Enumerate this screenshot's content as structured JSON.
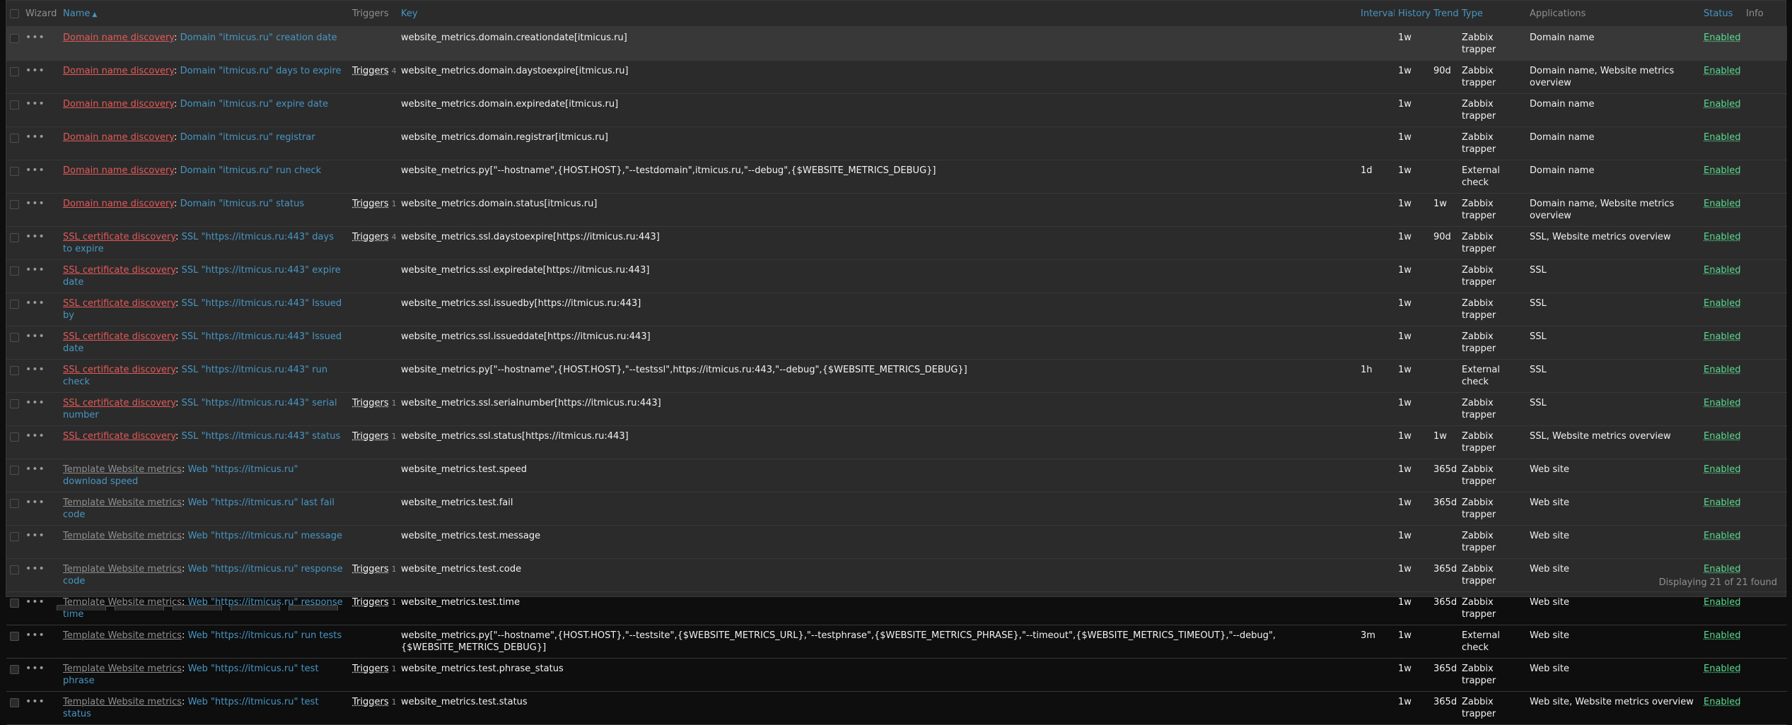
{
  "headers": {
    "wizard": "Wizard",
    "name": "Name",
    "name_sort": "▲",
    "triggers": "Triggers",
    "key": "Key",
    "interval": "Interval",
    "history": "History",
    "trends": "Trends",
    "type": "Type",
    "applications": "Applications",
    "status": "Status",
    "info": "Info"
  },
  "rows": [
    {
      "parent": "Domain name discovery",
      "parent_style": "red",
      "name": "Domain \"itmicus.ru\" creation date",
      "triggers": "",
      "trig_count": "",
      "key": "website_metrics.domain.creationdate[itmicus.ru]",
      "interval": "",
      "history": "1w",
      "trends": "",
      "type": "Zabbix trapper",
      "apps": "Domain name",
      "status": "Enabled"
    },
    {
      "parent": "Domain name discovery",
      "parent_style": "red",
      "name": "Domain \"itmicus.ru\" days to expire",
      "triggers": "Triggers",
      "trig_count": "4",
      "key": "website_metrics.domain.daystoexpire[itmicus.ru]",
      "interval": "",
      "history": "1w",
      "trends": "90d",
      "type": "Zabbix trapper",
      "apps": "Domain name, Website metrics overview",
      "status": "Enabled"
    },
    {
      "parent": "Domain name discovery",
      "parent_style": "red",
      "name": "Domain \"itmicus.ru\" expire date",
      "triggers": "",
      "trig_count": "",
      "key": "website_metrics.domain.expiredate[itmicus.ru]",
      "interval": "",
      "history": "1w",
      "trends": "",
      "type": "Zabbix trapper",
      "apps": "Domain name",
      "status": "Enabled"
    },
    {
      "parent": "Domain name discovery",
      "parent_style": "red",
      "name": "Domain \"itmicus.ru\" registrar",
      "triggers": "",
      "trig_count": "",
      "key": "website_metrics.domain.registrar[itmicus.ru]",
      "interval": "",
      "history": "1w",
      "trends": "",
      "type": "Zabbix trapper",
      "apps": "Domain name",
      "status": "Enabled"
    },
    {
      "parent": "Domain name discovery",
      "parent_style": "red",
      "name": "Domain \"itmicus.ru\" run check",
      "triggers": "",
      "trig_count": "",
      "key": "website_metrics.py[\"--hostname\",{HOST.HOST},\"--testdomain\",itmicus.ru,\"--debug\",{$WEBSITE_METRICS_DEBUG}]",
      "interval": "1d",
      "history": "1w",
      "trends": "",
      "type": "External check",
      "apps": "Domain name",
      "status": "Enabled"
    },
    {
      "parent": "Domain name discovery",
      "parent_style": "red",
      "name": "Domain \"itmicus.ru\" status",
      "triggers": "Triggers",
      "trig_count": "1",
      "key": "website_metrics.domain.status[itmicus.ru]",
      "interval": "",
      "history": "1w",
      "trends": "1w",
      "type": "Zabbix trapper",
      "apps": "Domain name, Website metrics overview",
      "status": "Enabled"
    },
    {
      "parent": "SSL certificate discovery",
      "parent_style": "red",
      "name": "SSL \"https://itmicus.ru:443\" days to expire",
      "triggers": "Triggers",
      "trig_count": "4",
      "key": "website_metrics.ssl.daystoexpire[https://itmicus.ru:443]",
      "interval": "",
      "history": "1w",
      "trends": "90d",
      "type": "Zabbix trapper",
      "apps": "SSL, Website metrics overview",
      "status": "Enabled"
    },
    {
      "parent": "SSL certificate discovery",
      "parent_style": "red",
      "name": "SSL \"https://itmicus.ru:443\" expire date",
      "triggers": "",
      "trig_count": "",
      "key": "website_metrics.ssl.expiredate[https://itmicus.ru:443]",
      "interval": "",
      "history": "1w",
      "trends": "",
      "type": "Zabbix trapper",
      "apps": "SSL",
      "status": "Enabled"
    },
    {
      "parent": "SSL certificate discovery",
      "parent_style": "red",
      "name": "SSL \"https://itmicus.ru:443\" Issued by",
      "triggers": "",
      "trig_count": "",
      "key": "website_metrics.ssl.issuedby[https://itmicus.ru:443]",
      "interval": "",
      "history": "1w",
      "trends": "",
      "type": "Zabbix trapper",
      "apps": "SSL",
      "status": "Enabled"
    },
    {
      "parent": "SSL certificate discovery",
      "parent_style": "red",
      "name": "SSL \"https://itmicus.ru:443\" Issued date",
      "triggers": "",
      "trig_count": "",
      "key": "website_metrics.ssl.issueddate[https://itmicus.ru:443]",
      "interval": "",
      "history": "1w",
      "trends": "",
      "type": "Zabbix trapper",
      "apps": "SSL",
      "status": "Enabled"
    },
    {
      "parent": "SSL certificate discovery",
      "parent_style": "red",
      "name": "SSL \"https://itmicus.ru:443\" run check",
      "triggers": "",
      "trig_count": "",
      "key": "website_metrics.py[\"--hostname\",{HOST.HOST},\"--testssl\",https://itmicus.ru:443,\"--debug\",{$WEBSITE_METRICS_DEBUG}]",
      "interval": "1h",
      "history": "1w",
      "trends": "",
      "type": "External check",
      "apps": "SSL",
      "status": "Enabled"
    },
    {
      "parent": "SSL certificate discovery",
      "parent_style": "red",
      "name": "SSL \"https://itmicus.ru:443\" serial number",
      "triggers": "Triggers",
      "trig_count": "1",
      "key": "website_metrics.ssl.serialnumber[https://itmicus.ru:443]",
      "interval": "",
      "history": "1w",
      "trends": "",
      "type": "Zabbix trapper",
      "apps": "SSL",
      "status": "Enabled"
    },
    {
      "parent": "SSL certificate discovery",
      "parent_style": "red",
      "name": "SSL \"https://itmicus.ru:443\" status",
      "triggers": "Triggers",
      "trig_count": "1",
      "key": "website_metrics.ssl.status[https://itmicus.ru:443]",
      "interval": "",
      "history": "1w",
      "trends": "1w",
      "type": "Zabbix trapper",
      "apps": "SSL, Website metrics overview",
      "status": "Enabled"
    },
    {
      "parent": "Template Website metrics",
      "parent_style": "gray",
      "name": "Web \"https://itmicus.ru\" download speed",
      "triggers": "",
      "trig_count": "",
      "key": "website_metrics.test.speed",
      "interval": "",
      "history": "1w",
      "trends": "365d",
      "type": "Zabbix trapper",
      "apps": "Web site",
      "status": "Enabled"
    },
    {
      "parent": "Template Website metrics",
      "parent_style": "gray",
      "name": "Web \"https://itmicus.ru\" last fail code",
      "triggers": "",
      "trig_count": "",
      "key": "website_metrics.test.fail",
      "interval": "",
      "history": "1w",
      "trends": "365d",
      "type": "Zabbix trapper",
      "apps": "Web site",
      "status": "Enabled"
    },
    {
      "parent": "Template Website metrics",
      "parent_style": "gray",
      "name": "Web \"https://itmicus.ru\" message",
      "triggers": "",
      "trig_count": "",
      "key": "website_metrics.test.message",
      "interval": "",
      "history": "1w",
      "trends": "",
      "type": "Zabbix trapper",
      "apps": "Web site",
      "status": "Enabled"
    },
    {
      "parent": "Template Website metrics",
      "parent_style": "gray",
      "name": "Web \"https://itmicus.ru\" response code",
      "triggers": "Triggers",
      "trig_count": "1",
      "key": "website_metrics.test.code",
      "interval": "",
      "history": "1w",
      "trends": "365d",
      "type": "Zabbix trapper",
      "apps": "Web site",
      "status": "Enabled"
    },
    {
      "parent": "Template Website metrics",
      "parent_style": "gray",
      "name": "Web \"https://itmicus.ru\" response time",
      "triggers": "Triggers",
      "trig_count": "1",
      "key": "website_metrics.test.time",
      "interval": "",
      "history": "1w",
      "trends": "365d",
      "type": "Zabbix trapper",
      "apps": "Web site",
      "status": "Enabled"
    },
    {
      "parent": "Template Website metrics",
      "parent_style": "gray",
      "name": "Web \"https://itmicus.ru\" run tests",
      "triggers": "",
      "trig_count": "",
      "key": "website_metrics.py[\"--hostname\",{HOST.HOST},\"--testsite\",{$WEBSITE_METRICS_URL},\"--testphrase\",{$WEBSITE_METRICS_PHRASE},\"--timeout\",{$WEBSITE_METRICS_TIMEOUT},\"--debug\",{$WEBSITE_METRICS_DEBUG}]",
      "interval": "3m",
      "history": "1w",
      "trends": "",
      "type": "External check",
      "apps": "Web site",
      "status": "Enabled"
    },
    {
      "parent": "Template Website metrics",
      "parent_style": "gray",
      "name": "Web \"https://itmicus.ru\" test phrase",
      "triggers": "Triggers",
      "trig_count": "1",
      "key": "website_metrics.test.phrase_status",
      "interval": "",
      "history": "1w",
      "trends": "365d",
      "type": "Zabbix trapper",
      "apps": "Web site",
      "status": "Enabled"
    },
    {
      "parent": "Template Website metrics",
      "parent_style": "gray",
      "name": "Web \"https://itmicus.ru\" test status",
      "triggers": "Triggers",
      "trig_count": "1",
      "key": "website_metrics.test.status",
      "interval": "",
      "history": "1w",
      "trends": "365d",
      "type": "Zabbix trapper",
      "apps": "Web site, Website metrics overview",
      "status": "Enabled"
    }
  ],
  "footer": "Displaying 21 of 21 found",
  "wizard_glyph": "•••",
  "name_separator": ": "
}
